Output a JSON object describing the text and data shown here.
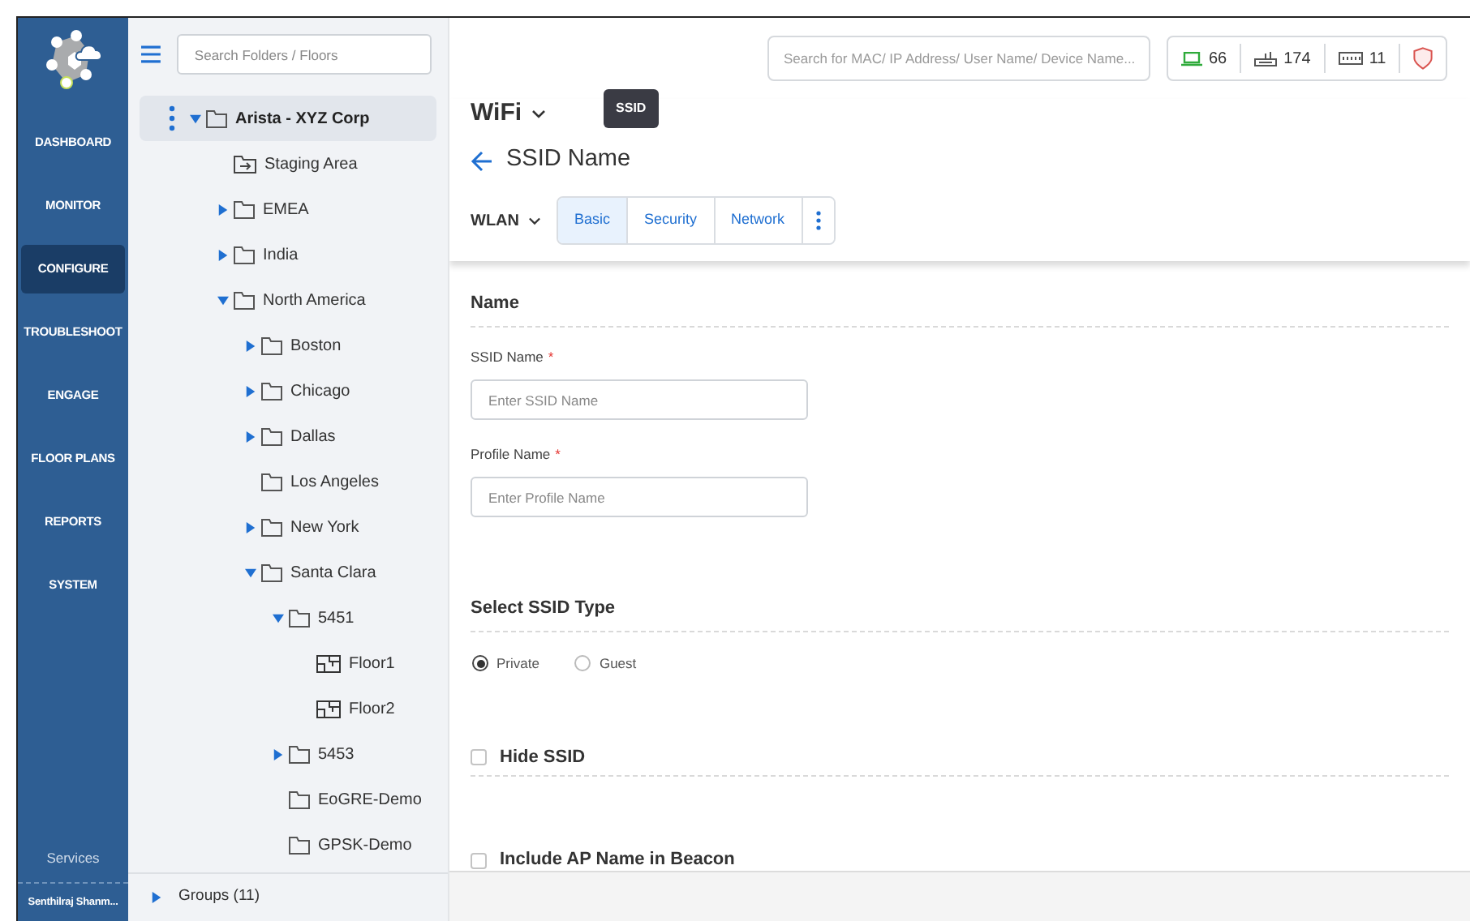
{
  "nav": {
    "items": [
      {
        "label": "DASHBOARD",
        "selected": false
      },
      {
        "label": "MONITOR",
        "selected": false
      },
      {
        "label": "CONFIGURE",
        "selected": true
      },
      {
        "label": "TROUBLESHOOT",
        "selected": false
      },
      {
        "label": "ENGAGE",
        "selected": false
      },
      {
        "label": "FLOOR PLANS",
        "selected": false
      },
      {
        "label": "REPORTS",
        "selected": false
      },
      {
        "label": "SYSTEM",
        "selected": false
      }
    ],
    "services": "Services",
    "user": "Senthilraj Shanm..."
  },
  "tree": {
    "search": {
      "placeholder": "Search Folders / Floors"
    },
    "items": [
      {
        "label": "Arista - XYZ Corp",
        "kind": "folder",
        "expanded": true,
        "selected": true,
        "children": [
          {
            "label": "Staging Area",
            "kind": "staging",
            "selected": false
          },
          {
            "label": "EMEA",
            "kind": "folder",
            "expanded": false,
            "selected": false
          },
          {
            "label": "India",
            "kind": "folder",
            "expanded": false,
            "selected": false
          },
          {
            "label": "North America",
            "kind": "folder",
            "expanded": true,
            "selected": false,
            "children": [
              {
                "label": "Boston",
                "kind": "folder",
                "expanded": false,
                "selected": false
              },
              {
                "label": "Chicago",
                "kind": "folder",
                "expanded": false,
                "selected": false
              },
              {
                "label": "Dallas",
                "kind": "folder",
                "expanded": false,
                "selected": false
              },
              {
                "label": "Los Angeles",
                "kind": "folder",
                "selected": false
              },
              {
                "label": "New York",
                "kind": "folder",
                "expanded": false,
                "selected": false
              },
              {
                "label": "Santa Clara",
                "kind": "folder",
                "expanded": true,
                "selected": false,
                "children": [
                  {
                    "label": "5451",
                    "kind": "folder",
                    "expanded": true,
                    "selected": false,
                    "children": [
                      {
                        "label": "Floor1",
                        "kind": "floor",
                        "selected": false
                      },
                      {
                        "label": "Floor2",
                        "kind": "floor",
                        "selected": false
                      }
                    ]
                  },
                  {
                    "label": "5453",
                    "kind": "folder",
                    "expanded": false,
                    "selected": false
                  },
                  {
                    "label": "EoGRE-Demo",
                    "kind": "folder",
                    "selected": false
                  },
                  {
                    "label": "GPSK-Demo",
                    "kind": "folder",
                    "selected": false
                  }
                ]
              }
            ]
          }
        ]
      }
    ],
    "groups": {
      "label": "Groups (11)",
      "expanded": false
    }
  },
  "topbar": {
    "search": {
      "placeholder": "Search for MAC/ IP Address/ User Name/ Device Name..."
    },
    "counters": [
      {
        "kind": "clients",
        "value": "66"
      },
      {
        "kind": "aps",
        "value": "174"
      },
      {
        "kind": "switches",
        "value": "11"
      },
      {
        "kind": "alerts"
      }
    ]
  },
  "page": {
    "menu": "WiFi",
    "tooltip": "SSID",
    "title": "SSID Name",
    "submenu": "WLAN",
    "tabs": [
      {
        "label": "Basic",
        "selected": true
      },
      {
        "label": "Security",
        "selected": false
      },
      {
        "label": "Network",
        "selected": false
      }
    ],
    "sections": [
      {
        "kind": "fields",
        "heading": "Name",
        "fields": [
          {
            "label": "SSID Name",
            "required_mark": "*",
            "placeholder": "Enter SSID Name"
          },
          {
            "label": "Profile Name",
            "required_mark": "*",
            "placeholder": "Enter Profile Name"
          }
        ]
      },
      {
        "kind": "radios",
        "heading": "Select SSID Type",
        "options": [
          {
            "label": "Private",
            "selected": true
          },
          {
            "label": "Guest",
            "selected": false
          }
        ]
      },
      {
        "kind": "checkbox",
        "label": "Hide SSID",
        "checked": false
      },
      {
        "kind": "checkbox",
        "label": "Include AP Name in Beacon",
        "checked": false
      }
    ]
  }
}
